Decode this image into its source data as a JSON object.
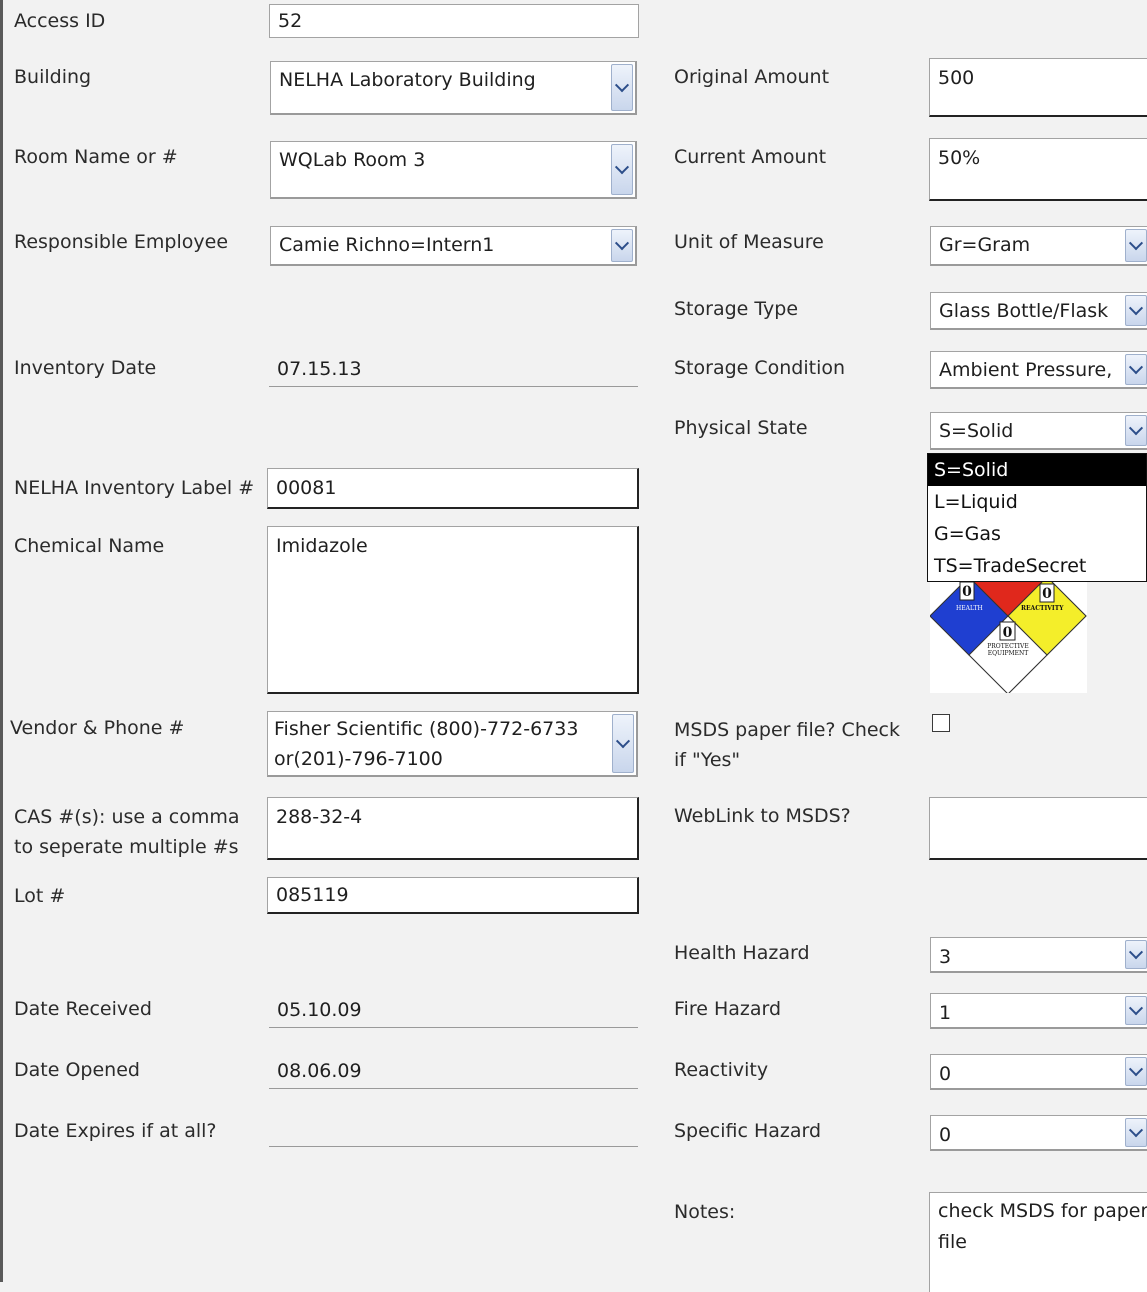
{
  "left": {
    "access_id": {
      "label": "Access ID",
      "value": "52"
    },
    "building": {
      "label": "Building",
      "value": "NELHA Laboratory Building"
    },
    "room": {
      "label": "Room Name or #",
      "value": "WQLab Room 3"
    },
    "employee": {
      "label": "Responsible Employee",
      "value": "Camie Richno=Intern1"
    },
    "inventory_date": {
      "label": "Inventory Date",
      "value": "07.15.13"
    },
    "label_num": {
      "label": "NELHA Inventory Label #",
      "value": "00081"
    },
    "chemical": {
      "label": "Chemical Name",
      "value": "Imidazole"
    },
    "vendor": {
      "label": "Vendor & Phone #",
      "value": "Fisher Scientific  (800)-772-6733 or(201)-796-7100"
    },
    "cas": {
      "label": "CAS #(s): use a comma to seperate multiple #s",
      "value": "288-32-4"
    },
    "lot": {
      "label": "Lot #",
      "value": "085119"
    },
    "date_received": {
      "label": "Date Received",
      "value": "05.10.09"
    },
    "date_opened": {
      "label": "Date Opened",
      "value": "08.06.09"
    },
    "date_expires": {
      "label": "Date Expires if at all?",
      "value": ""
    }
  },
  "right": {
    "original_amount": {
      "label": "Original Amount",
      "value": "500"
    },
    "current_amount": {
      "label": "Current Amount",
      "value": "50%"
    },
    "unit": {
      "label": "Unit of Measure",
      "value": "Gr=Gram"
    },
    "storage_type": {
      "label": "Storage Type",
      "value": "Glass Bottle/Flask"
    },
    "storage_condition": {
      "label": "Storage Condition",
      "value": "Ambient Pressure,"
    },
    "physical_state": {
      "label": "Physical State",
      "value": "S=Solid"
    },
    "physical_state_options": [
      "S=Solid",
      "L=Liquid",
      "G=Gas",
      "TS=TradeSecret"
    ],
    "msds_paper": {
      "label": "MSDS paper file? Check if \"Yes\"",
      "checked": false
    },
    "weblink": {
      "label": "WebLink to MSDS?",
      "value": ""
    },
    "health": {
      "label": "Health Hazard",
      "value": "3"
    },
    "fire": {
      "label": "Fire Hazard",
      "value": "1"
    },
    "reactivity": {
      "label": "Reactivity",
      "value": "0"
    },
    "specific": {
      "label": "Specific Hazard",
      "value": "0"
    },
    "notes": {
      "label": "Notes:",
      "value": "check MSDS for paper file"
    }
  },
  "nfpa": {
    "health_num": "0",
    "reactivity_num": "0",
    "protective_num": "0",
    "health_text": "HEALTH",
    "reactivity_text": "REACTIVITY",
    "protective_text1": "PROTECTIVE",
    "protective_text2": "EQUIPMENT",
    "colors": {
      "health": "#1f3fd1",
      "fire": "#e0281c",
      "reactivity": "#f4ee2a",
      "special": "#ffffff"
    }
  }
}
